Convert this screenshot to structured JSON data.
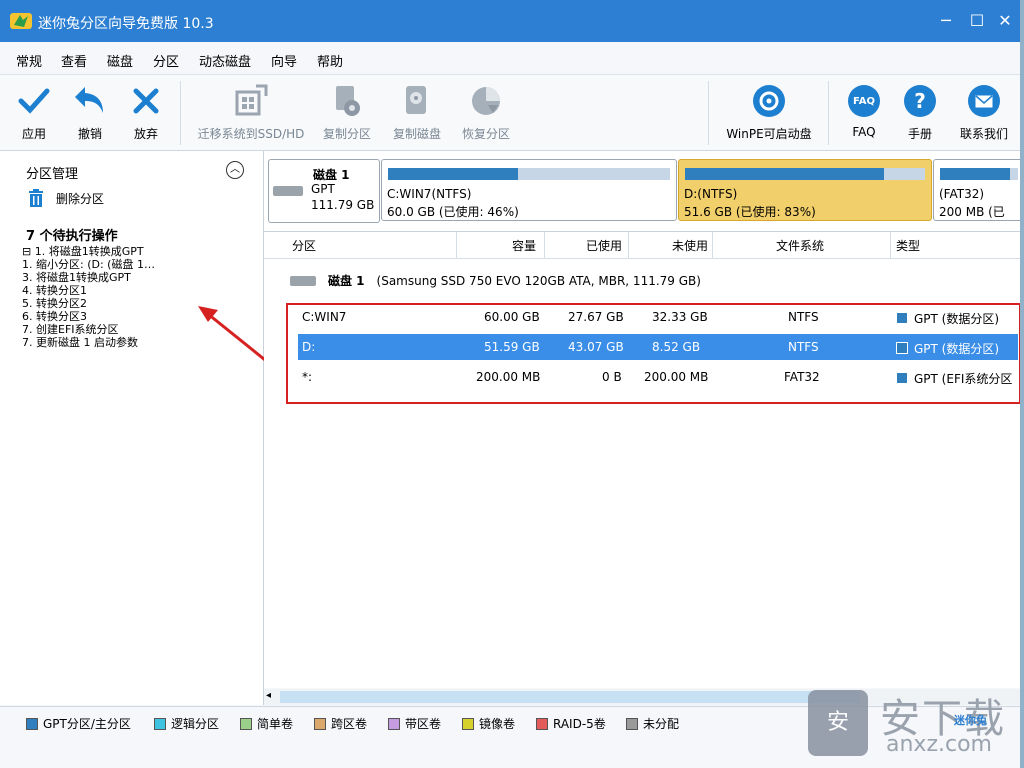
{
  "window": {
    "title": "迷你兔分区向导免费版 10.3"
  },
  "menu": [
    "常规",
    "查看",
    "磁盘",
    "分区",
    "动态磁盘",
    "向导",
    "帮助"
  ],
  "toolbar": {
    "apply": "应用",
    "undo": "撤销",
    "discard": "放弃",
    "migrate": "迁移系统到SSD/HD",
    "copy_partition": "复制分区",
    "copy_disk": "复制磁盘",
    "recover_partition": "恢复分区",
    "winpe": "WinPE可启动盘",
    "faq": "FAQ",
    "faq_icon_text": "FAQ",
    "manual": "手册",
    "contact": "联系我们"
  },
  "left": {
    "section_title": "分区管理",
    "delete_partition": "删除分区",
    "pending_title": "7 个待执行操作",
    "tree": [
      "⊟ 1. 将磁盘1转换成GPT",
      "   1. 缩小分区: (D: (磁盘 1…",
      "   3. 将磁盘1转换成GPT",
      "   4. 转换分区1",
      "   5. 转换分区2",
      "   6. 转换分区3",
      "   7. 创建EFI系统分区",
      "   7. 更新磁盘 1 启动参数"
    ]
  },
  "diskmap": {
    "disk_name": "磁盘 1",
    "disk_type": "GPT",
    "disk_size": "111.79 GB",
    "partitions": [
      {
        "name": "C:WIN7(NTFS)",
        "detail": "60.0 GB (已使用: 46%)",
        "used": 0.46
      },
      {
        "name": "D:(NTFS)",
        "detail": "51.6 GB (已使用: 83%)",
        "used": 0.83
      },
      {
        "name": "(FAT32)",
        "detail": "200 MB (已",
        "used": 0.9
      }
    ]
  },
  "table": {
    "headers": [
      "分区",
      "容量",
      "已使用",
      "未使用",
      "文件系统",
      "类型"
    ],
    "disk_label": "磁盘 1",
    "disk_desc": "(Samsung SSD 750 EVO 120GB ATA, MBR, 111.79 GB)",
    "rows": [
      {
        "partition": "C:WIN7",
        "capacity": "60.00 GB",
        "used": "27.67 GB",
        "unused": "32.33 GB",
        "fs": "NTFS",
        "type": "GPT (数据分区)"
      },
      {
        "partition": "D:",
        "capacity": "51.59 GB",
        "used": "43.07 GB",
        "unused": "8.52 GB",
        "fs": "NTFS",
        "type": "GPT (数据分区)"
      },
      {
        "partition": "*:",
        "capacity": "200.00 MB",
        "used": "0 B",
        "unused": "200.00 MB",
        "fs": "FAT32",
        "type": "GPT (EFI系统分区"
      }
    ]
  },
  "legend": [
    {
      "label": "GPT分区/主分区",
      "color": "#2f7fbf"
    },
    {
      "label": "逻辑分区",
      "color": "#3fc3e0"
    },
    {
      "label": "简单卷",
      "color": "#9bd08a"
    },
    {
      "label": "跨区卷",
      "color": "#d9a86a"
    },
    {
      "label": "带区卷",
      "color": "#c79be0"
    },
    {
      "label": "镜像卷",
      "color": "#d6d12b"
    },
    {
      "label": "RAID-5卷",
      "color": "#e35b5b"
    },
    {
      "label": "未分配",
      "color": "#9a9a9a"
    }
  ],
  "watermark": {
    "big": "安下载",
    "small": "anxz.com",
    "logo": "迷你兔",
    "badge": "安"
  },
  "colors": {
    "titlebar": "#2c7fd2",
    "selected_row": "#3a8ee8",
    "selected_block": "#f1cf6a",
    "annotation": "#d62121"
  }
}
